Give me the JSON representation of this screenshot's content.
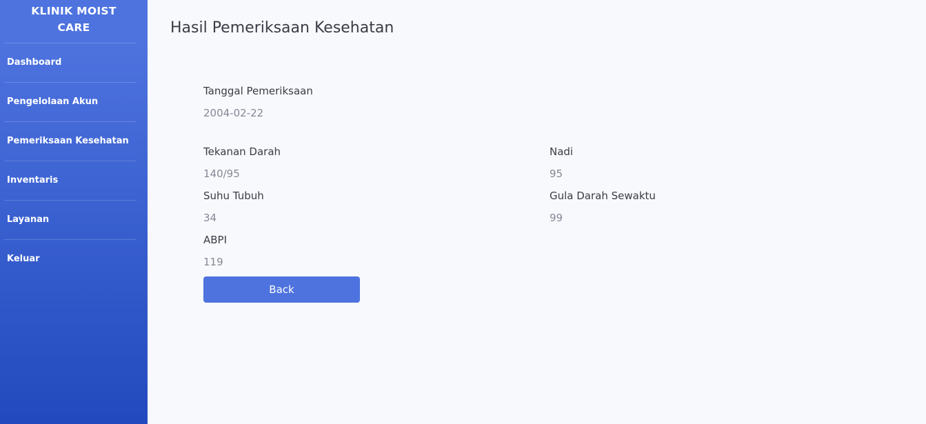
{
  "sidebar": {
    "brand_line1": "KLINIK MOIST",
    "brand_line2": "CARE",
    "items": [
      {
        "label": "Dashboard"
      },
      {
        "label": "Pengelolaan Akun"
      },
      {
        "label": "Pemeriksaan Kesehatan"
      },
      {
        "label": "Inventaris"
      },
      {
        "label": "Layanan"
      },
      {
        "label": "Keluar"
      }
    ]
  },
  "main": {
    "title": "Hasil Pemeriksaan Kesehatan",
    "fields": {
      "tanggal": {
        "label": "Tanggal Pemeriksaan",
        "value": "2004-02-22"
      },
      "tekanan_darah": {
        "label": "Tekanan Darah",
        "value": "140/95"
      },
      "nadi": {
        "label": "Nadi",
        "value": "95"
      },
      "suhu_tubuh": {
        "label": "Suhu Tubuh",
        "value": "34"
      },
      "gula_darah": {
        "label": "Gula Darah Sewaktu",
        "value": "99"
      },
      "abpi": {
        "label": "ABPI",
        "value": "119"
      }
    },
    "back_label": "Back"
  },
  "colors": {
    "sidebar_top": "#4e73df",
    "sidebar_bottom": "#224abe",
    "button": "#4e73df",
    "background": "#f8f9fc"
  }
}
